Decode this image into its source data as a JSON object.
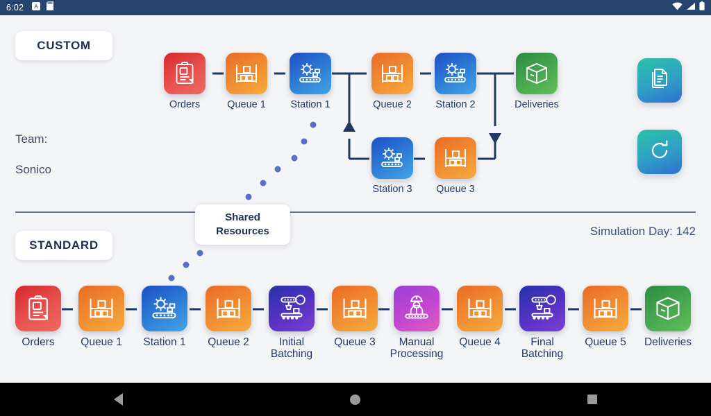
{
  "statusbar": {
    "time": "6:02",
    "icons": [
      "app-notification-icon",
      "sd-card-icon",
      "wifi-icon",
      "signal-icon",
      "battery-icon"
    ]
  },
  "navbar": {
    "back_label": "back-icon",
    "home_label": "home-icon",
    "recents_label": "recents-icon"
  },
  "panels": {
    "custom_label": "CUSTOM",
    "standard_label": "STANDARD"
  },
  "team": {
    "label": "Team:",
    "name": "Sonico"
  },
  "simulation": {
    "day_text": "Simulation Day: 142",
    "day_number": 142
  },
  "shared_resources": {
    "line1": "Shared",
    "line2": "Resources"
  },
  "actions": [
    {
      "name": "reports-button",
      "icon": "documents-icon",
      "color": "#2cc2a6"
    },
    {
      "name": "reset-button",
      "icon": "refresh-icon",
      "color": "#2cc2a6"
    }
  ],
  "custom_flow": {
    "main": [
      {
        "label": "Orders",
        "icon": "clipboard-icon",
        "color": "red"
      },
      {
        "label": "Queue 1",
        "icon": "rack-icon",
        "color": "orange"
      },
      {
        "label": "Station 1",
        "icon": "gear-conveyor-icon",
        "color": "blue"
      },
      {
        "label": "Queue 2",
        "icon": "rack-icon",
        "color": "orange"
      },
      {
        "label": "Station 2",
        "icon": "gear-conveyor-icon",
        "color": "blue"
      },
      {
        "label": "Deliveries",
        "icon": "box-icon",
        "color": "green"
      }
    ],
    "branch": [
      {
        "label": "Station 3",
        "icon": "gear-conveyor-icon",
        "color": "blue"
      },
      {
        "label": "Queue 3",
        "icon": "rack-icon",
        "color": "orange"
      }
    ]
  },
  "standard_flow": [
    {
      "label": "Orders",
      "icon": "clipboard-icon",
      "color": "red"
    },
    {
      "label": "Queue 1",
      "icon": "rack-icon",
      "color": "orange"
    },
    {
      "label": "Station 1",
      "icon": "gear-conveyor-icon",
      "color": "blue"
    },
    {
      "label": "Queue 2",
      "icon": "rack-icon",
      "color": "orange"
    },
    {
      "label": "Initial\nBatching",
      "icon": "robot-arm-icon",
      "color": "indigo"
    },
    {
      "label": "Queue 3",
      "icon": "rack-icon",
      "color": "orange"
    },
    {
      "label": "Manual\nProcessing",
      "icon": "worker-icon",
      "color": "purple"
    },
    {
      "label": "Queue 4",
      "icon": "rack-icon",
      "color": "orange"
    },
    {
      "label": "Final\nBatching",
      "icon": "robot-arm-icon",
      "color": "indigo"
    },
    {
      "label": "Queue 5",
      "icon": "rack-icon",
      "color": "orange"
    },
    {
      "label": "Deliveries",
      "icon": "box-icon",
      "color": "green"
    }
  ]
}
